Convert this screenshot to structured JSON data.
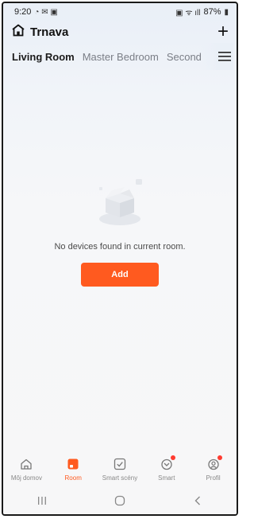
{
  "status": {
    "time": "9:20",
    "battery": "87%"
  },
  "header": {
    "home_name": "Trnava",
    "add_symbol": "+"
  },
  "rooms": {
    "tabs": [
      "Living Room",
      "Master Bedroom",
      "Second"
    ],
    "active_index": 0
  },
  "empty_state": {
    "message": "No devices found in current room.",
    "add_label": "Add"
  },
  "bottom_nav": {
    "items": [
      {
        "label": "Môj domov",
        "icon": "home-icon"
      },
      {
        "label": "Room",
        "icon": "room-icon"
      },
      {
        "label": "Smart scény",
        "icon": "scene-check-icon"
      },
      {
        "label": "Smart",
        "icon": "smart-icon"
      },
      {
        "label": "Profil",
        "icon": "profile-icon"
      }
    ],
    "active_index": 1
  },
  "colors": {
    "accent": "#ff5a1f",
    "badge": "#ff3b30"
  }
}
